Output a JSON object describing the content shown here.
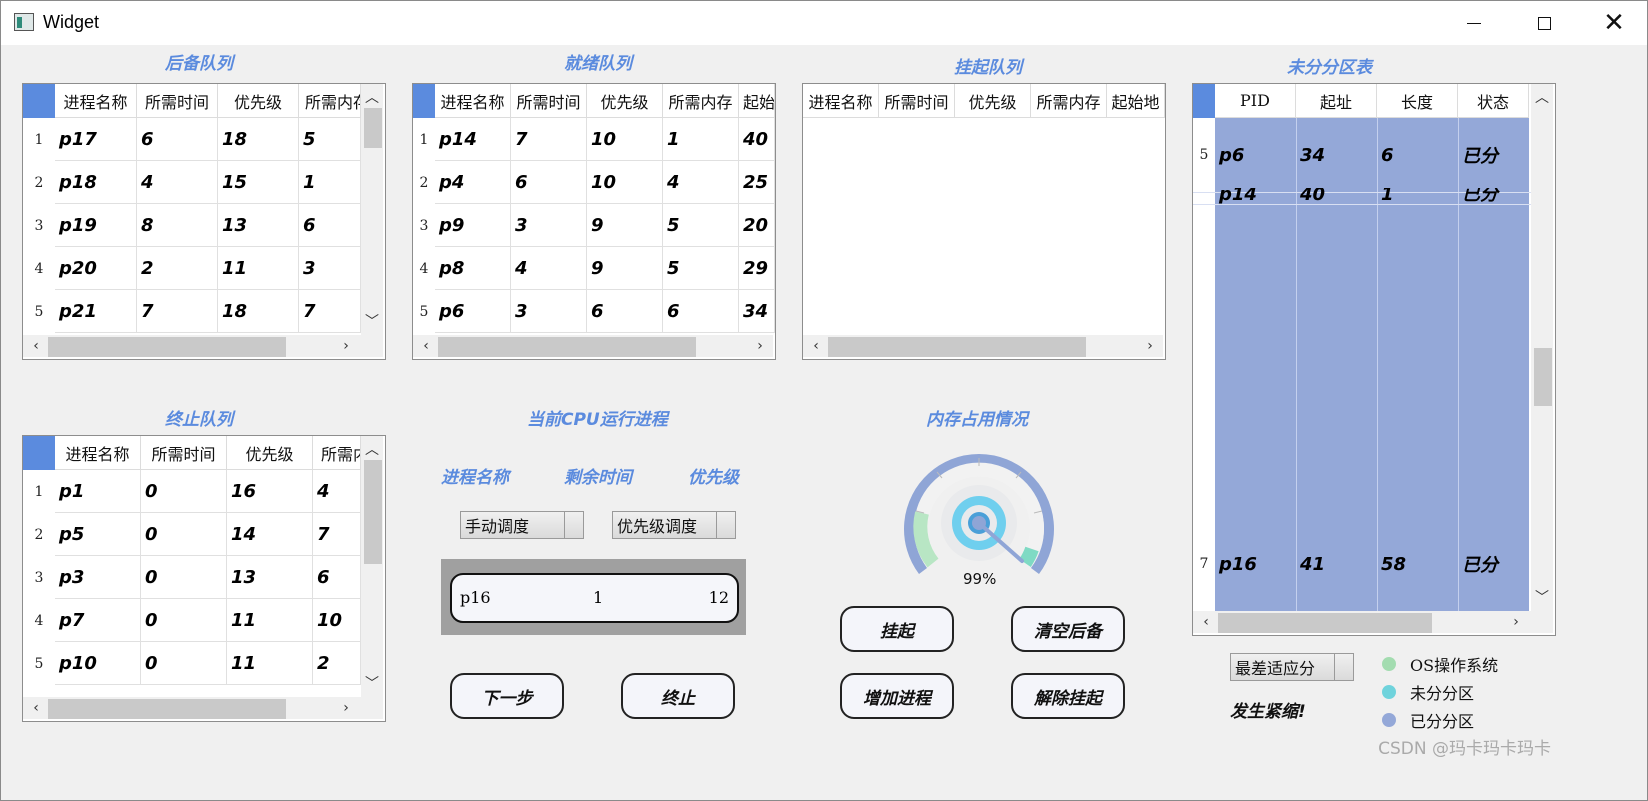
{
  "window": {
    "title": "Widget"
  },
  "sections": {
    "backup": "后备队列",
    "ready": "就绪队列",
    "suspend": "挂起队列",
    "free": "未分分区表",
    "terminated": "终止队列",
    "cpu": "当前CPU运行进程",
    "memory": "内存占用情况"
  },
  "backup_table": {
    "headers": [
      "进程名称",
      "所需时间",
      "优先级",
      "所需内存"
    ],
    "rows": [
      {
        "idx": "1",
        "cells": [
          "p17",
          "6",
          "18",
          "5"
        ]
      },
      {
        "idx": "2",
        "cells": [
          "p18",
          "4",
          "15",
          "1"
        ]
      },
      {
        "idx": "3",
        "cells": [
          "p19",
          "8",
          "13",
          "6"
        ]
      },
      {
        "idx": "4",
        "cells": [
          "p20",
          "2",
          "11",
          "3"
        ]
      },
      {
        "idx": "5",
        "cells": [
          "p21",
          "7",
          "18",
          "7"
        ]
      }
    ]
  },
  "ready_table": {
    "headers": [
      "进程名称",
      "所需时间",
      "优先级",
      "所需内存",
      "起始"
    ],
    "rows": [
      {
        "idx": "1",
        "cells": [
          "p14",
          "7",
          "10",
          "1",
          "40"
        ]
      },
      {
        "idx": "2",
        "cells": [
          "p4",
          "6",
          "10",
          "4",
          "25"
        ]
      },
      {
        "idx": "3",
        "cells": [
          "p9",
          "3",
          "9",
          "5",
          "20"
        ]
      },
      {
        "idx": "4",
        "cells": [
          "p8",
          "4",
          "9",
          "5",
          "29"
        ]
      },
      {
        "idx": "5",
        "cells": [
          "p6",
          "3",
          "6",
          "6",
          "34"
        ]
      }
    ]
  },
  "suspend_table": {
    "headers": [
      "进程名称",
      "所需时间",
      "优先级",
      "所需内存",
      "起始地"
    ]
  },
  "terminated_table": {
    "headers": [
      "进程名称",
      "所需时间",
      "优先级",
      "所需内"
    ],
    "rows": [
      {
        "idx": "1",
        "cells": [
          "p1",
          "0",
          "16",
          "4"
        ]
      },
      {
        "idx": "2",
        "cells": [
          "p5",
          "0",
          "14",
          "7"
        ]
      },
      {
        "idx": "3",
        "cells": [
          "p3",
          "0",
          "13",
          "6"
        ]
      },
      {
        "idx": "4",
        "cells": [
          "p7",
          "0",
          "11",
          "10"
        ]
      },
      {
        "idx": "5",
        "cells": [
          "p10",
          "0",
          "11",
          "2"
        ]
      }
    ]
  },
  "partition_table": {
    "headers": [
      "PID",
      "起址",
      "长度",
      "状态"
    ],
    "rows": [
      {
        "idx": "5",
        "cells": [
          "p6",
          "34",
          "6",
          "已分"
        ]
      },
      {
        "idx": "",
        "cells": [
          "p14",
          "40",
          "1",
          "已分"
        ]
      },
      {
        "idx": "7",
        "cells": [
          "p16",
          "41",
          "58",
          "已分"
        ]
      }
    ],
    "fill_color": "#94a8d8"
  },
  "cpu": {
    "labels": {
      "name": "进程名称",
      "remaining": "剩余时间",
      "priority": "优先级"
    },
    "schedule_mode": "手动调度",
    "algorithm": "优先级调度",
    "running": {
      "name": "p16",
      "remaining": "1",
      "priority": "12"
    }
  },
  "memory": {
    "percent_label": "99%",
    "percent": 0.99
  },
  "buttons": {
    "next": "下一步",
    "terminate": "终止",
    "suspend": "挂起",
    "clear_backup": "清空后备",
    "add_process": "增加进程",
    "resume": "解除挂起"
  },
  "fit_strategy": "最差适应分",
  "compact_msg": "发生紧缩!",
  "legend": [
    {
      "label": "OS操作系统",
      "color": "#a3dcb0"
    },
    {
      "label": "未分分区",
      "color": "#6fd3dc"
    },
    {
      "label": "已分分区",
      "color": "#94a8d8"
    }
  ],
  "watermark": "CSDN @玛卡玛卡玛卡"
}
